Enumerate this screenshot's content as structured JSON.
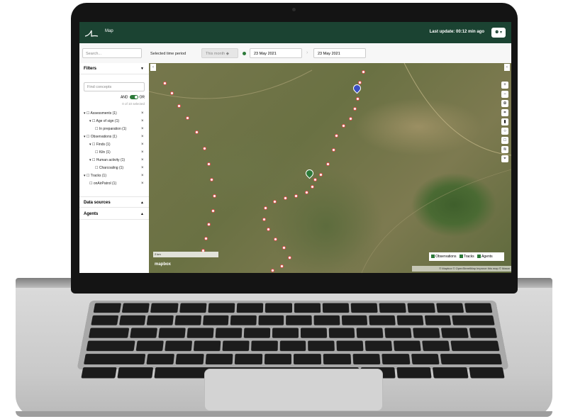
{
  "header": {
    "title": "Map",
    "last_update": "Last update: 00:12 min ago",
    "user_menu": "⚉ ▾"
  },
  "toolbar": {
    "search_placeholder": "Search...",
    "period_label": "Selected time period",
    "period_value": "This month ◆",
    "date_from": "23 May 2021",
    "date_to": "23 May 2021"
  },
  "sidebar": {
    "filters_label": "Filters",
    "find_placeholder": "Find concepts",
    "toggle_and": "AND",
    "toggle_or": "OR",
    "selected_count": "0 of 10 selected",
    "tree": [
      {
        "label": "▾ ☐ Assessments (1)"
      },
      {
        "label": "▾ ☐ Age of sign (1)"
      },
      {
        "label": "☐ In preparation (1)"
      },
      {
        "label": "▾ ☐ Observations (1)"
      },
      {
        "label": "▾ ☐ Finds (1)"
      },
      {
        "label": "☐ Kiln (1)"
      },
      {
        "label": "▾ ☐ Human activity (1)"
      },
      {
        "label": "☐ Charcoaling (1)"
      },
      {
        "label": "▾ ☐ Tracks (1)"
      },
      {
        "label": "☐ onAirPatrol (1)"
      }
    ],
    "data_sources_label": "Data sources",
    "agents_label": "Agents"
  },
  "map": {
    "scale_label": "2 km",
    "mapbox_label": "mapbox",
    "legend": {
      "observations": "Observations",
      "tracks": "Tracks",
      "agents": "Agents"
    },
    "attribution": "© Mapbox © OpenStreetMap Improve this map © Maxar"
  },
  "colors": {
    "brand": "#1b4332",
    "accent": "#2d7a3a",
    "track": "#e05050",
    "pin_blue": "#3b4fc4"
  }
}
